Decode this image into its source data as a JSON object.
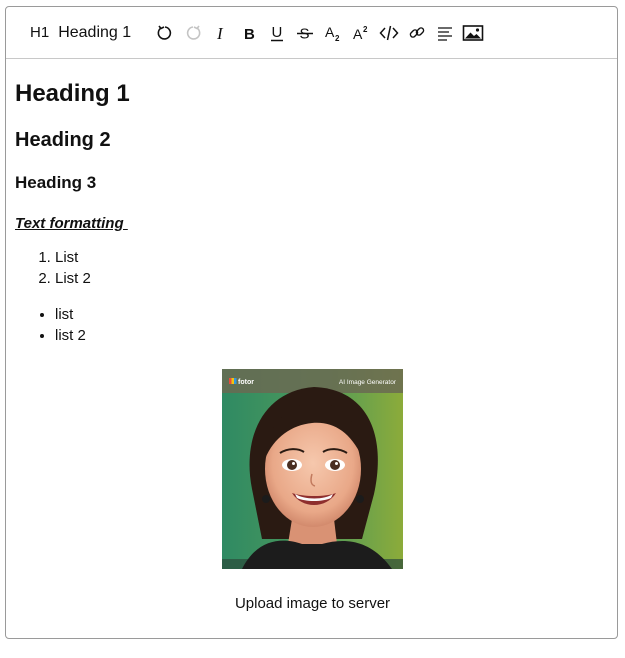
{
  "toolbar": {
    "block_icon": "H1",
    "block_label": "Heading 1",
    "buttons": [
      {
        "name": "undo-icon"
      },
      {
        "name": "redo-icon"
      },
      {
        "name": "italic-icon"
      },
      {
        "name": "bold-icon"
      },
      {
        "name": "underline-icon"
      },
      {
        "name": "strikethrough-icon"
      },
      {
        "name": "subscript-icon"
      },
      {
        "name": "superscript-icon"
      },
      {
        "name": "code-icon"
      },
      {
        "name": "link-icon"
      },
      {
        "name": "align-left-icon"
      },
      {
        "name": "image-icon"
      }
    ]
  },
  "content": {
    "h1": "Heading 1",
    "h2": "Heading 2",
    "h3": "Heading 3",
    "formatted": "Text formatting ",
    "ordered_list": [
      "List",
      "List 2"
    ],
    "bullet_list": [
      "list",
      "list 2"
    ],
    "image": {
      "brand": "fotor",
      "banner": "AI Image Generator",
      "colors": {
        "left": "#3a9a6e",
        "right": "#8fae3a",
        "face": "#f0b79a",
        "hair": "#2a1a12"
      }
    },
    "caption": "Upload image to server"
  }
}
